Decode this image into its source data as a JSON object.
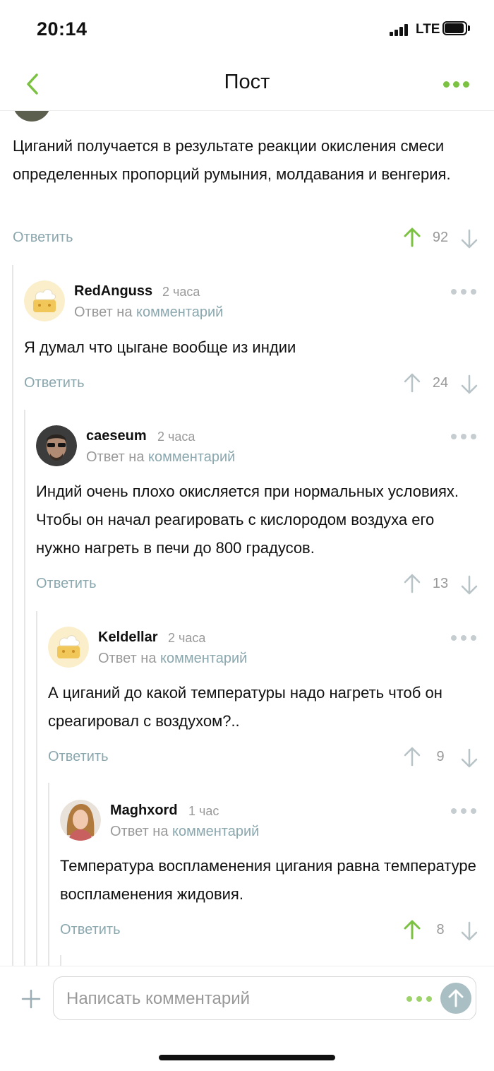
{
  "status_bar": {
    "time": "20:14",
    "network": "LTE"
  },
  "nav": {
    "title": "Пост"
  },
  "thread": {
    "reply_label": "Ответить",
    "replyto_prefix": "Ответ на",
    "replyto_link": "комментарий",
    "root": {
      "text": "Циганий получается в результате реакции окисления смеси определенных пропорций румыния, молдавания и венгерия.",
      "rating": "92",
      "upvoted": true
    },
    "comments": [
      {
        "author": "RedAnguss",
        "time": "2 часа",
        "text": "Я думал что цыгане вообще из индии",
        "rating": "24",
        "upvoted": false
      },
      {
        "author": "caeseum",
        "time": "2 часа",
        "text": "Индий очень плохо окисляется при нормальных условиях. Чтобы он начал реагировать с кислородом воздуха его нужно нагреть в печи до 800 градусов.",
        "rating": "13",
        "upvoted": false
      },
      {
        "author": "Keldellar",
        "time": "2 часа",
        "text": "А циганий до какой температуры надо нагреть чтоб он среагировал с воздухом?..",
        "rating": "9",
        "upvoted": false
      },
      {
        "author": "Maghxord",
        "time": "1 час",
        "text": "Температура воспламенения цигания равна температуре воспламенения жидовия.",
        "rating": "8",
        "upvoted": true
      }
    ]
  },
  "composer": {
    "placeholder": "Написать комментарий"
  },
  "colors": {
    "accent": "#7bc142",
    "link": "#8aa7ae",
    "muted": "#999999"
  }
}
